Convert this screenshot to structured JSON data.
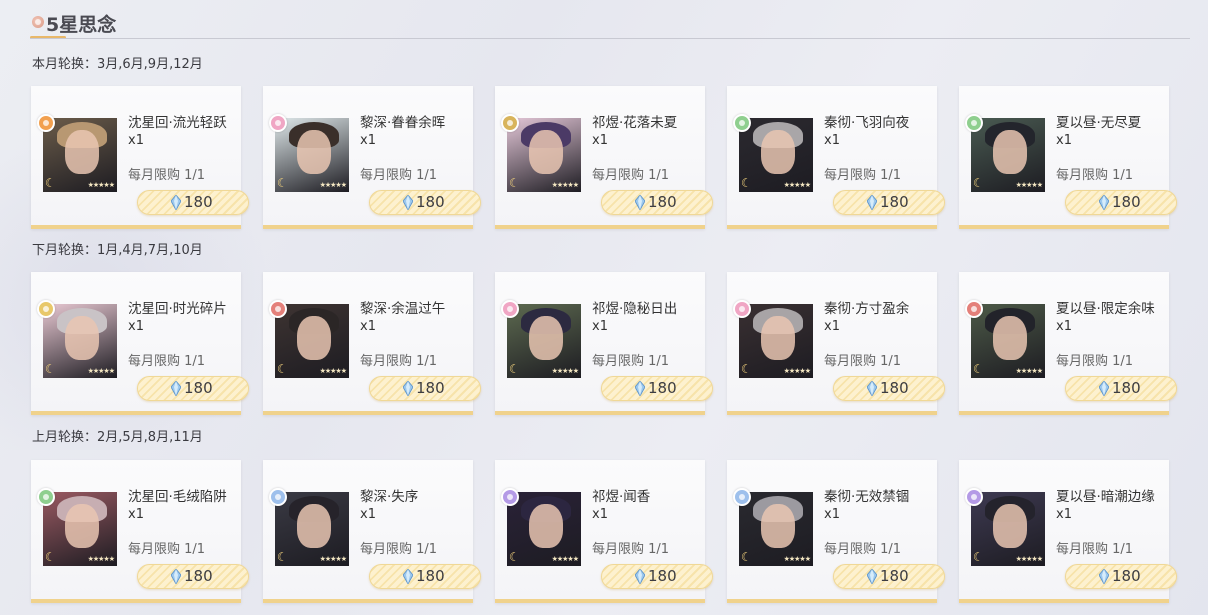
{
  "header": {
    "title": "5星思念"
  },
  "sections": [
    {
      "label": "本月轮换：3月,6月,9月,12月",
      "cards": [
        {
          "name": "沈星回·流光轻跃",
          "qty": "x1",
          "limit": "每月限购 1/1",
          "price": "180",
          "gem_color": "#f2a04f",
          "hair_color": "#b89872",
          "bg_color": "#6b5c4a"
        },
        {
          "name": "黎深·眷眷余晖",
          "qty": "x1",
          "limit": "每月限购 1/1",
          "price": "180",
          "gem_color": "#f0a6c4",
          "hair_color": "#3a2f2a",
          "bg_color": "#dfe8ea"
        },
        {
          "name": "祁煜·花落未夏",
          "qty": "x1",
          "limit": "每月限购 1/1",
          "price": "180",
          "gem_color": "#d8b45c",
          "hair_color": "#4b3a66",
          "bg_color": "#e4c7d8"
        },
        {
          "name": "秦彻·飞羽向夜",
          "qty": "x1",
          "limit": "每月限购 1/1",
          "price": "180",
          "gem_color": "#8fcf8f",
          "hair_color": "#a9a6a8",
          "bg_color": "#2c2a30"
        },
        {
          "name": "夏以昼·无尽夏",
          "qty": "x1",
          "limit": "每月限购 1/1",
          "price": "180",
          "gem_color": "#8fcf8f",
          "hair_color": "#23252c",
          "bg_color": "#4a5b52"
        }
      ]
    },
    {
      "label": "下月轮换：1月,4月,7月,10月",
      "cards": [
        {
          "name": "沈星回·时光碎片",
          "qty": "x1",
          "limit": "每月限购 1/1",
          "price": "180",
          "gem_color": "#e8c86a",
          "hair_color": "#c9c3c6",
          "bg_color": "#e9c9d3"
        },
        {
          "name": "黎深·余温过午",
          "qty": "x1",
          "limit": "每月限购 1/1",
          "price": "180",
          "gem_color": "#e4807a",
          "hair_color": "#2b2626",
          "bg_color": "#3e3432"
        },
        {
          "name": "祁煜·隐秘日出",
          "qty": "x1",
          "limit": "每月限购 1/1",
          "price": "180",
          "gem_color": "#f0a6c4",
          "hair_color": "#2c2a40",
          "bg_color": "#5d6a50"
        },
        {
          "name": "秦彻·方寸盈余",
          "qty": "x1",
          "limit": "每月限购 1/1",
          "price": "180",
          "gem_color": "#f0a6c4",
          "hair_color": "#a8a4a6",
          "bg_color": "#3a3032"
        },
        {
          "name": "夏以昼·限定余味",
          "qty": "x1",
          "limit": "每月限购 1/1",
          "price": "180",
          "gem_color": "#e4807a",
          "hair_color": "#22232a",
          "bg_color": "#4d5a48"
        }
      ]
    },
    {
      "label": "上月轮换：2月,5月,8月,11月",
      "cards": [
        {
          "name": "沈星回·毛绒陷阱",
          "qty": "x1",
          "limit": "每月限购 1/1",
          "price": "180",
          "gem_color": "#8fcf8f",
          "hair_color": "#c7aeb2",
          "bg_color": "#9a5a62"
        },
        {
          "name": "黎深·失序",
          "qty": "x1",
          "limit": "每月限购 1/1",
          "price": "180",
          "gem_color": "#9ec0ec",
          "hair_color": "#26232a",
          "bg_color": "#3a3a44"
        },
        {
          "name": "祁煜·闻香",
          "qty": "x1",
          "limit": "每月限购 1/1",
          "price": "180",
          "gem_color": "#b49ae6",
          "hair_color": "#2c2640",
          "bg_color": "#2a2238"
        },
        {
          "name": "秦彻·无效禁锢",
          "qty": "x1",
          "limit": "每月限购 1/1",
          "price": "180",
          "gem_color": "#9ec0ec",
          "hair_color": "#9c9aa0",
          "bg_color": "#2a2a30"
        },
        {
          "name": "夏以昼·暗潮边缘",
          "qty": "x1",
          "limit": "每月限购 1/1",
          "price": "180",
          "gem_color": "#b49ae6",
          "hair_color": "#24232c",
          "bg_color": "#3e3a52"
        }
      ]
    }
  ]
}
